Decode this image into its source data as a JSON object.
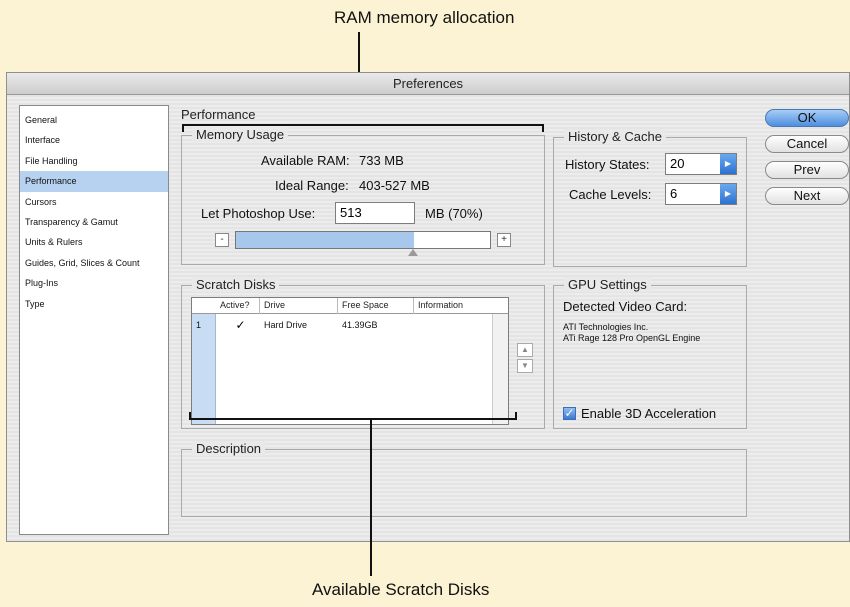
{
  "annotations": {
    "top": "RAM memory allocation",
    "bottom": "Available Scratch Disks"
  },
  "window": {
    "title": "Preferences"
  },
  "sidebar": {
    "items": [
      {
        "label": "General"
      },
      {
        "label": "Interface"
      },
      {
        "label": "File Handling"
      },
      {
        "label": "Performance",
        "selected": true
      },
      {
        "label": "Cursors"
      },
      {
        "label": "Transparency & Gamut"
      },
      {
        "label": "Units & Rulers"
      },
      {
        "label": "Guides, Grid, Slices & Count"
      },
      {
        "label": "Plug-Ins"
      },
      {
        "label": "Type"
      }
    ]
  },
  "panel": {
    "title": "Performance"
  },
  "memory": {
    "title": "Memory Usage",
    "available_label": "Available RAM:",
    "available_value": "733 MB",
    "ideal_label": "Ideal Range:",
    "ideal_value": "403-527 MB",
    "use_label": "Let Photoshop Use:",
    "use_value": "513",
    "use_unit": "MB (70%)",
    "minus": "-",
    "plus": "+",
    "slider_fraction": 0.7
  },
  "history": {
    "title": "History & Cache",
    "states_label": "History States:",
    "states_value": "20",
    "cache_label": "Cache Levels:",
    "cache_value": "6"
  },
  "buttons": {
    "ok": "OK",
    "cancel": "Cancel",
    "prev": "Prev",
    "next": "Next"
  },
  "scratch": {
    "title": "Scratch Disks",
    "columns": [
      "Active?",
      "Drive",
      "Free Space",
      "Information"
    ],
    "rows": [
      {
        "num": "1",
        "active": true,
        "drive": "Hard Drive",
        "free": "41.39GB",
        "info": ""
      }
    ]
  },
  "gpu": {
    "title": "GPU Settings",
    "detected_label": "Detected Video Card:",
    "line1": "ATI Technologies Inc.",
    "line2": "ATi Rage 128 Pro OpenGL Engine",
    "accel_label": "Enable 3D Acceleration",
    "accel_checked": true
  },
  "description": {
    "title": "Description"
  },
  "colors": {
    "background": "#fbf3d3",
    "selection": "#b6d2f0",
    "accent": "#3a7ad4"
  }
}
